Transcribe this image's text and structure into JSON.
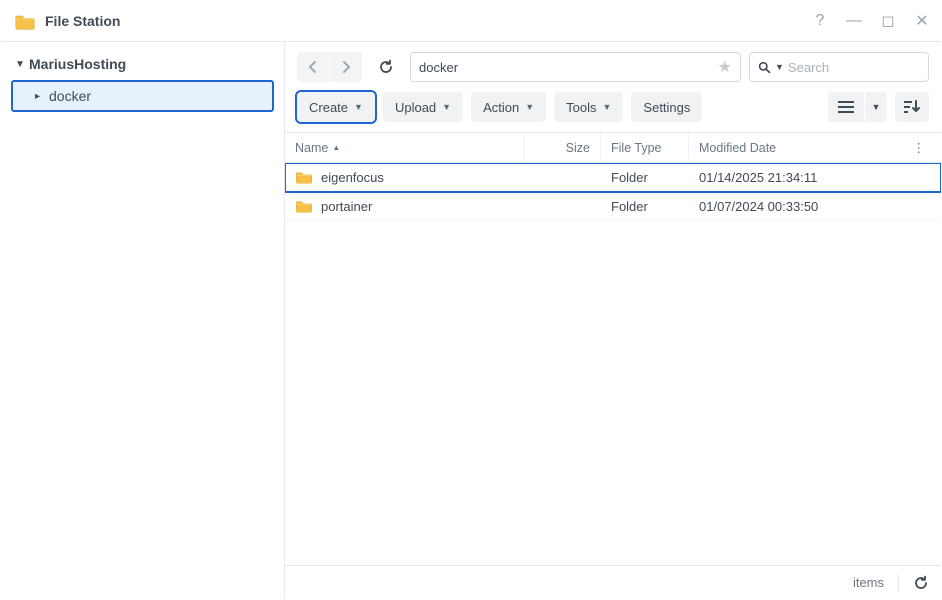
{
  "app": {
    "title": "File Station"
  },
  "window_controls": {
    "help": "?",
    "minimize": "—",
    "maximize": "◻",
    "close": "✕"
  },
  "sidebar": {
    "root_label": "MariusHosting",
    "items": [
      {
        "label": "docker",
        "selected": true
      }
    ]
  },
  "breadcrumb": {
    "path": "docker"
  },
  "search": {
    "placeholder": "Search"
  },
  "toolbar": {
    "create_label": "Create",
    "upload_label": "Upload",
    "action_label": "Action",
    "tools_label": "Tools",
    "settings_label": "Settings"
  },
  "columns": {
    "name": "Name",
    "size": "Size",
    "type": "File Type",
    "modified": "Modified Date"
  },
  "rows": [
    {
      "name": "eigenfocus",
      "size": "",
      "type": "Folder",
      "modified": "01/14/2025 21:34:11",
      "highlight": true
    },
    {
      "name": "portainer",
      "size": "",
      "type": "Folder",
      "modified": "01/07/2024 00:33:50",
      "highlight": false
    }
  ],
  "statusbar": {
    "items_label": "items"
  }
}
